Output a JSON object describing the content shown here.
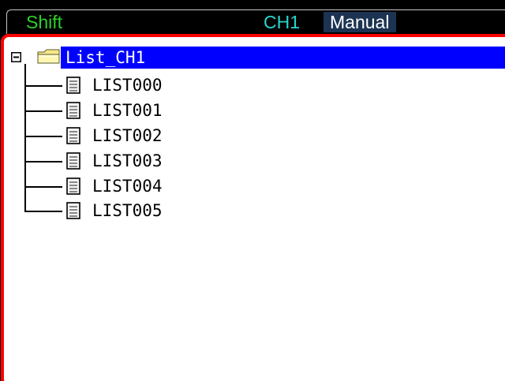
{
  "status_bar": {
    "shift_label": "Shift",
    "channel_label": "CH1",
    "mode_label": "Manual",
    "colors": {
      "shift": "#2bd12b",
      "channel": "#27d6cf",
      "mode_background": "#1c3452"
    }
  },
  "file_browser": {
    "root": {
      "label": "List_CH1",
      "expand_state": "expanded",
      "icon": "folder-icon",
      "selected": true,
      "selection_color": "#0000ff"
    },
    "files": [
      {
        "label": "LIST000",
        "icon": "file-icon"
      },
      {
        "label": "LIST001",
        "icon": "file-icon"
      },
      {
        "label": "LIST002",
        "icon": "file-icon"
      },
      {
        "label": "LIST003",
        "icon": "file-icon"
      },
      {
        "label": "LIST004",
        "icon": "file-icon"
      },
      {
        "label": "LIST005",
        "icon": "file-icon"
      }
    ],
    "border_color": "#ff0000"
  }
}
